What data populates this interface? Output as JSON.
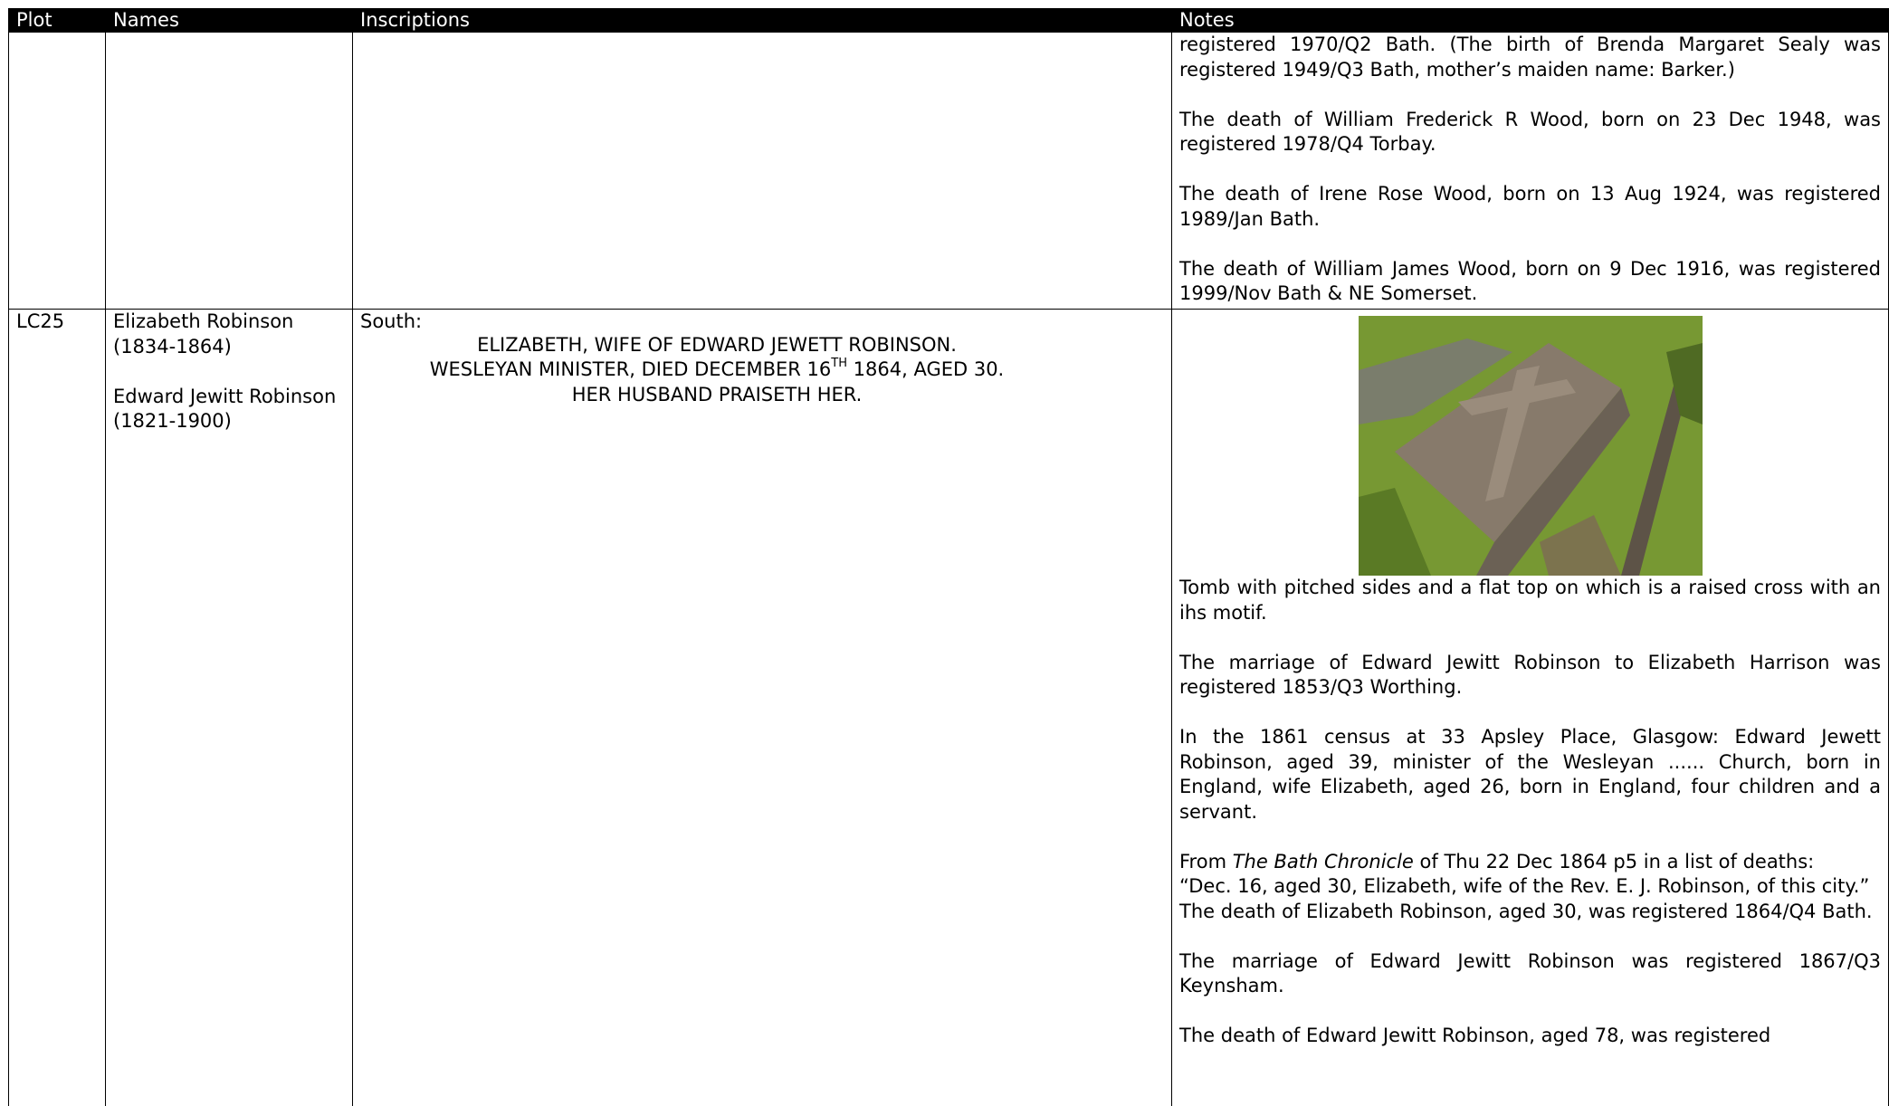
{
  "headers": {
    "plot": "Plot",
    "names": "Names",
    "inscriptions": "Inscriptions",
    "notes": "Notes"
  },
  "continued_row": {
    "notes": [
      "registered 1970/Q2 Bath. (The birth of Brenda Margaret Sealy was registered 1949/Q3 Bath, mother’s maiden name: Barker.)",
      "The death of William Frederick R Wood, born on 23 Dec 1948, was registered 1978/Q4 Torbay.",
      "The death of Irene Rose Wood, born on 13 Aug 1924, was registered 1989/Jan Bath.",
      "The death of William James Wood, born on 9 Dec 1916, was registered 1999/Nov Bath & NE Somerset."
    ]
  },
  "lc25": {
    "plot": "LC25",
    "name1": "Elizabeth Robinson (1834-1864)",
    "name2": "Edward Jewitt Robinson (1821-1900)",
    "inscription_label": "South:",
    "inscription_line1": "ELIZABETH, WIFE OF EDWARD JEWETT ROBINSON.",
    "inscription_line2_a": "WESLEYAN MINISTER, DIED DECEMBER 16",
    "inscription_line2_sup": "TH",
    "inscription_line2_b": " 1864, AGED 30.",
    "inscription_line3": "HER HUSBAND PRAISETH HER.",
    "photo_colors": {
      "grass": "#6f8f2e",
      "stone": "#857a6c"
    },
    "note_tomb": "Tomb with pitched sides and a flat top on which is a raised cross with an ihs motif.",
    "note_marriage1": "The marriage of Edward Jewitt Robinson to Elizabeth Harrison was registered 1853/Q3 Worthing.",
    "note_census": "In the 1861 census at 33 Apsley Place, Glasgow: Edward Jewett Robinson, aged 39, minister of the Wesleyan ...... Church, born in England, wife Elizabeth, aged 26, born in England, four children and a servant.",
    "note_chronicle_pre": "From ",
    "note_chronicle_title": "The Bath Chronicle",
    "note_chronicle_post": " of Thu 22 Dec 1864 p5 in a list of deaths:",
    "note_chronicle_quote": "“Dec. 16, aged 30, Elizabeth, wife of the Rev. E. J. Robinson, of this city.”",
    "note_death_elizabeth": "The death of Elizabeth Robinson, aged 30, was registered 1864/Q4 Bath.",
    "note_marriage2": "The marriage of Edward Jewitt Robinson was registered 1867/Q3 Keynsham.",
    "note_death_edward": "The death of Edward Jewitt Robinson, aged 78, was registered"
  }
}
